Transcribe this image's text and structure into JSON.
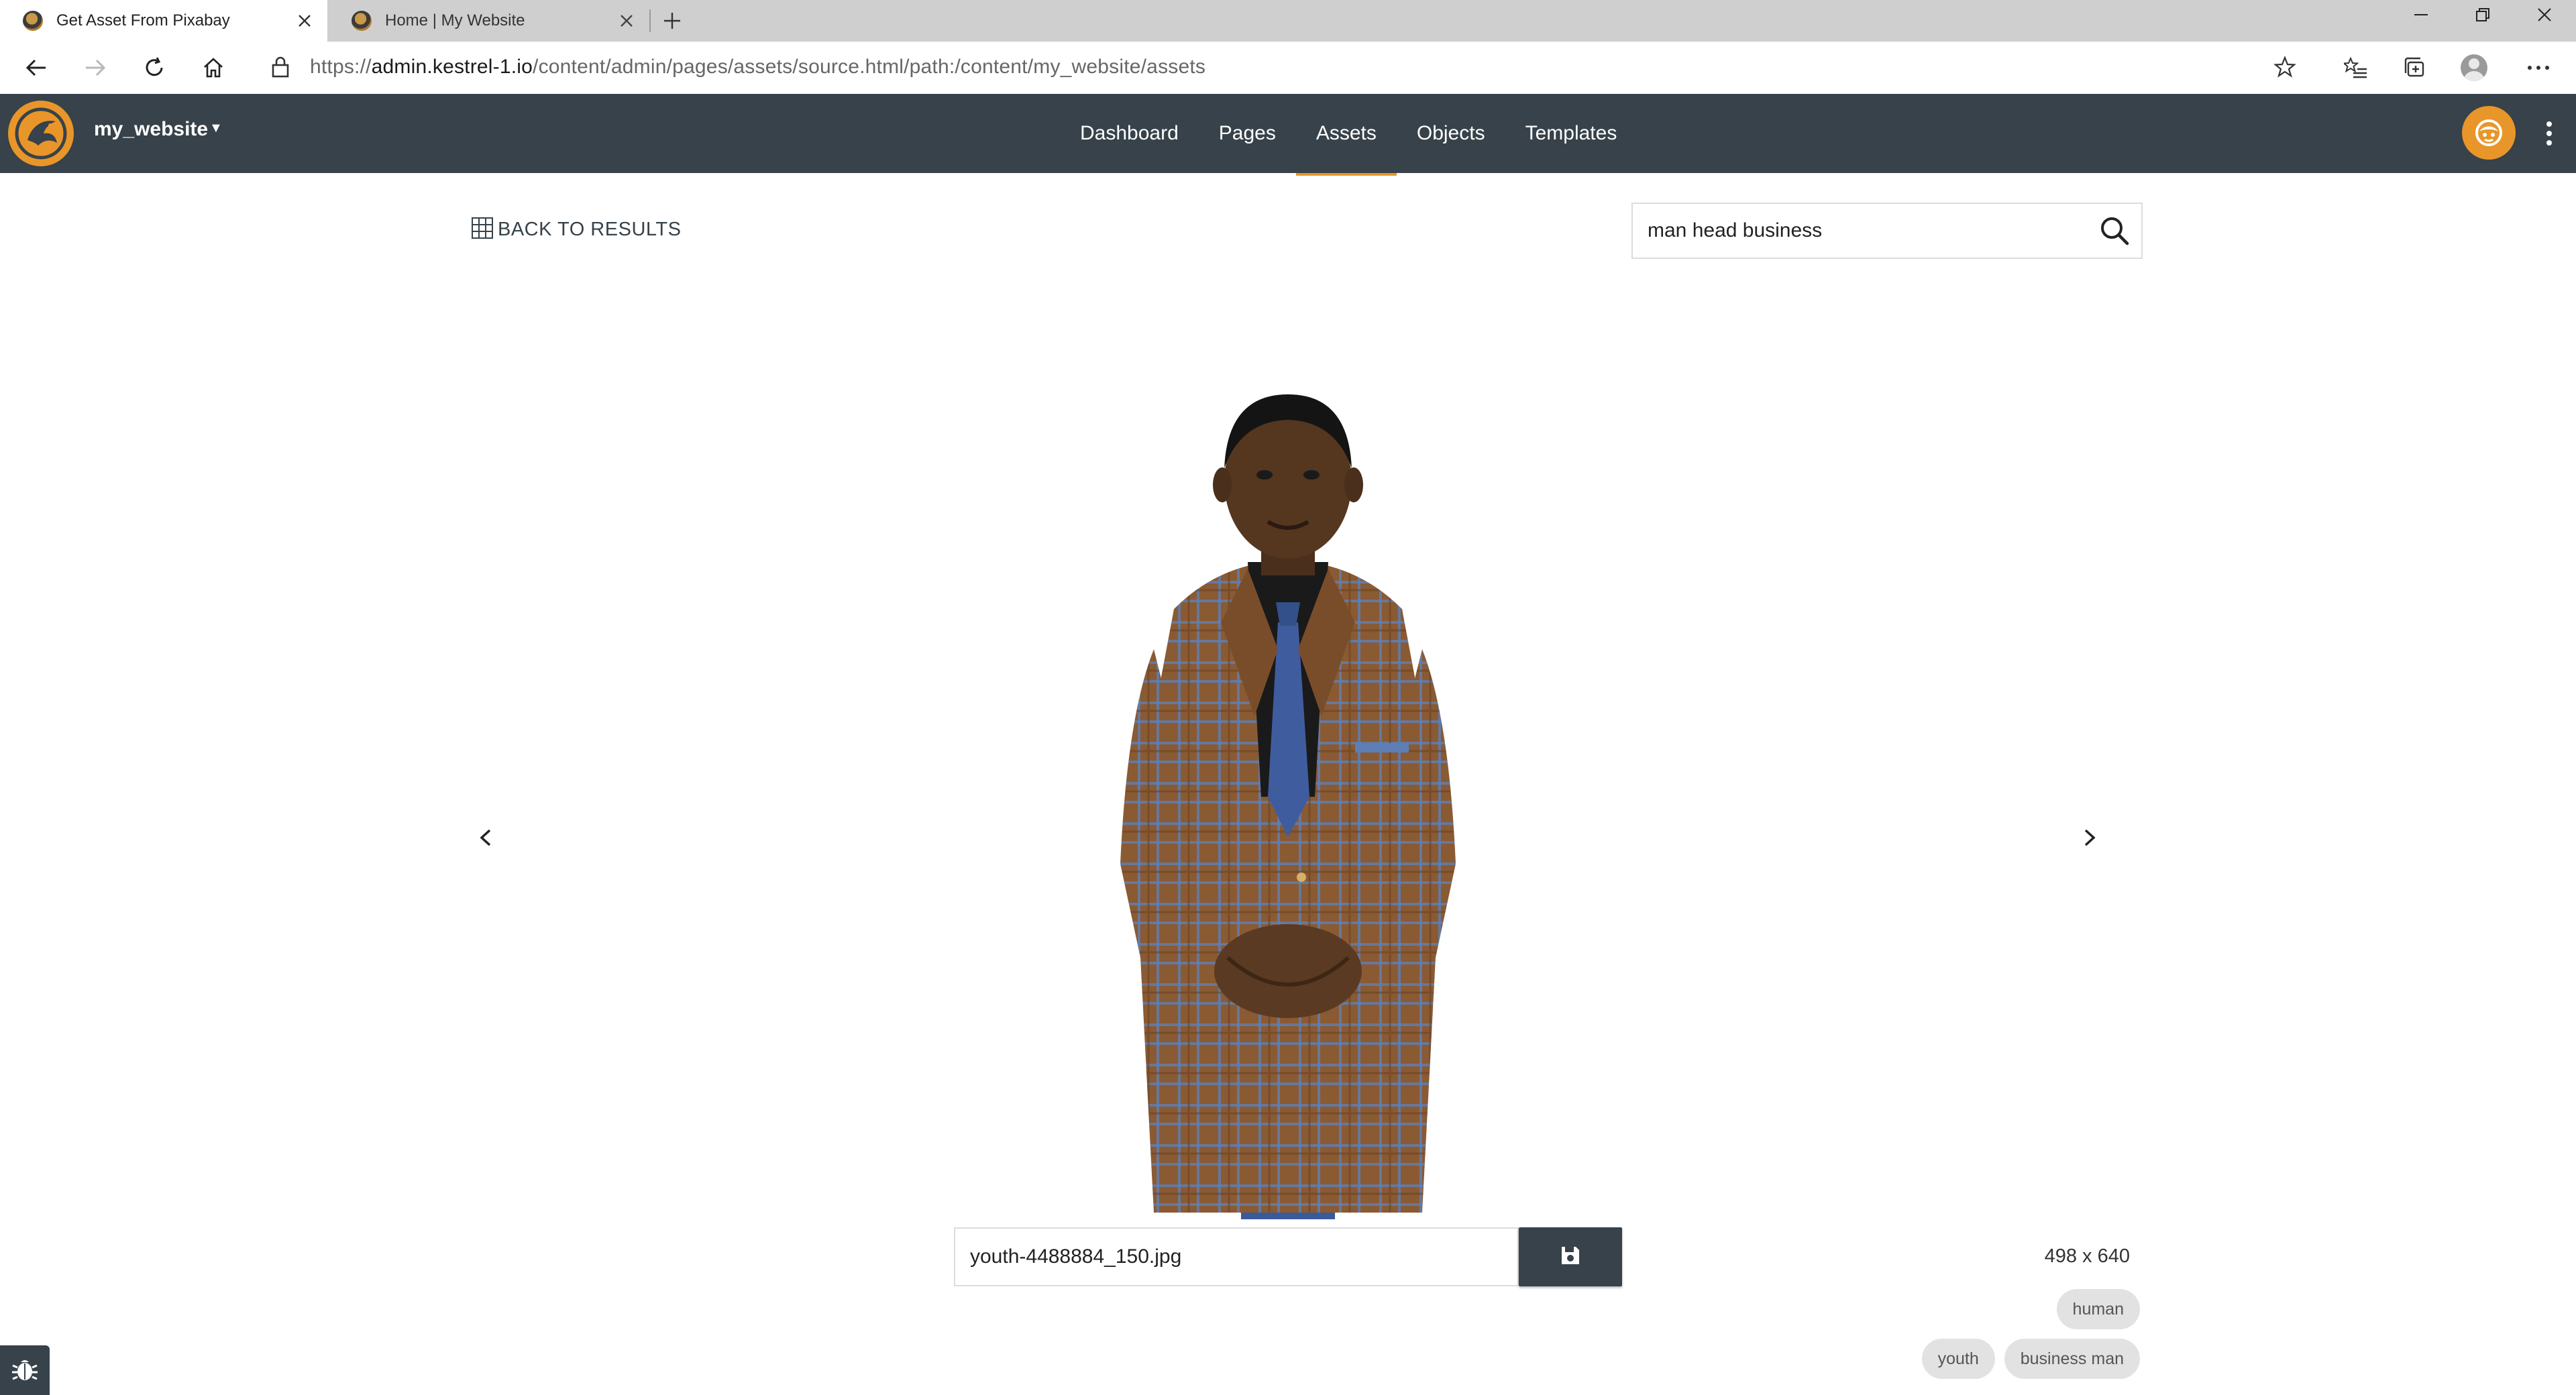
{
  "browser": {
    "tabs": [
      {
        "title": "Get Asset From Pixabay",
        "active": true
      },
      {
        "title": "Home | My Website",
        "active": false
      }
    ],
    "url": {
      "scheme": "https://",
      "host": "admin.kestrel-1.io",
      "path": "/content/admin/pages/assets/source.html/path:/content/my_website/assets"
    }
  },
  "app": {
    "site_name": "my_website",
    "nav": [
      {
        "label": "Dashboard"
      },
      {
        "label": "Pages"
      },
      {
        "label": "Assets",
        "active": true
      },
      {
        "label": "Objects"
      },
      {
        "label": "Templates"
      }
    ],
    "accent": "#e8962a",
    "header_bg": "#37424a"
  },
  "content": {
    "back_label": "BACK TO RESULTS",
    "search_value": "man head business",
    "filename_value": "youth-4488884_150.jpg",
    "dimensions": "498 x 640",
    "tags": [
      "human",
      "youth",
      "business man"
    ],
    "icons": {
      "back": "grid-icon",
      "search": "search-icon",
      "save": "floppy-disk-icon",
      "prev": "chevron-left-icon",
      "next": "chevron-right-icon",
      "debug": "bug-icon"
    }
  }
}
